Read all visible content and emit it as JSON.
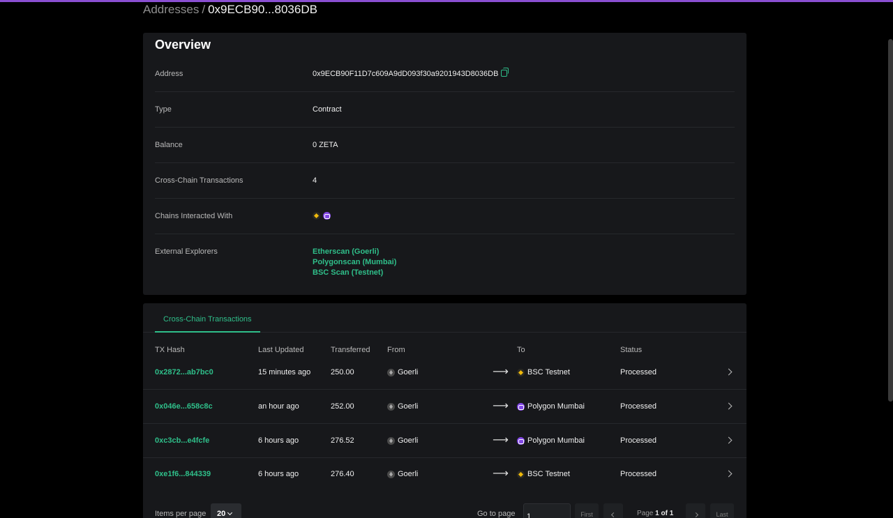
{
  "breadcrumb": {
    "root": "Addresses",
    "separator": "/",
    "current": "0x9ECB90...8036DB"
  },
  "overview": {
    "title": "Overview",
    "address_label": "Address",
    "address_value": "0x9ECB90F11D7c609A9dD093f30a9201943D8036DB",
    "type_label": "Type",
    "type_value": "Contract",
    "balance_label": "Balance",
    "balance_value": "0 ZETA",
    "ccx_label": "Cross-Chain Transactions",
    "ccx_value": "4",
    "chains_label": "Chains Interacted With",
    "chains_icons": [
      "bnb-chain-icon",
      "polygon-icon"
    ],
    "explorers_label": "External Explorers",
    "explorers": [
      "Etherscan (Goerli)",
      "Polygonscan (Mumbai)",
      "BSC Scan (Testnet)"
    ]
  },
  "tx": {
    "tab_label": "Cross-Chain Transactions",
    "headers": [
      "TX Hash",
      "Last Updated",
      "Transferred",
      "From",
      "To",
      "Status"
    ],
    "rows": [
      {
        "hash": "0x2872...ab7bc0",
        "updated": "15 minutes ago",
        "amount": "250.00",
        "from": "Goerli",
        "from_icon": "ethereum-icon",
        "to": "BSC Testnet",
        "to_icon": "bnb-chain-icon",
        "status": "Processed"
      },
      {
        "hash": "0x046e...658c8c",
        "updated": "an hour ago",
        "amount": "252.00",
        "from": "Goerli",
        "from_icon": "ethereum-icon",
        "to": "Polygon Mumbai",
        "to_icon": "polygon-icon",
        "status": "Processed"
      },
      {
        "hash": "0xc3cb...e4fcfe",
        "updated": "6 hours ago",
        "amount": "276.52",
        "from": "Goerli",
        "from_icon": "ethereum-icon",
        "to": "Polygon Mumbai",
        "to_icon": "polygon-icon",
        "status": "Processed"
      },
      {
        "hash": "0xe1f6...844339",
        "updated": "6 hours ago",
        "amount": "276.40",
        "from": "Goerli",
        "from_icon": "ethereum-icon",
        "to": "BSC Testnet",
        "to_icon": "bnb-chain-icon",
        "status": "Processed"
      }
    ],
    "arrow": "⟶"
  },
  "pagination": {
    "items_per_page_label": "Items per page",
    "items_per_page_value": "20",
    "goto_label": "Go to page",
    "goto_value": "1",
    "first_label": "First",
    "last_label": "Last",
    "page_prefix": "Page",
    "page_current": "1 of 1"
  },
  "colors": {
    "accent": "#2fbf8a",
    "brand_bar": "#8a4fd1",
    "card_bg": "#17181b"
  }
}
